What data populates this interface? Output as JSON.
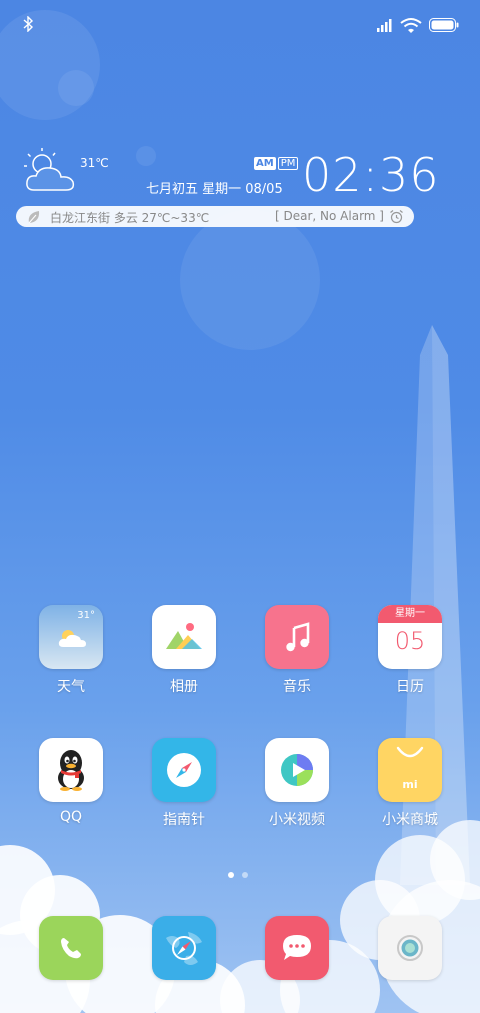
{
  "status_bar": {
    "left_icons": [
      "bluetooth-icon"
    ],
    "right_icons": [
      "signal-icon",
      "wifi-icon",
      "battery-icon"
    ]
  },
  "widget": {
    "weather_icon": "partly-cloudy-icon",
    "current_temp": "31℃",
    "am_label": "AM",
    "pm_label": "PM",
    "time": "02:36",
    "date_text": "七月初五   星期一   08/05",
    "location_text": "白龙江东街  多云  27℃~33℃",
    "alarm_text": "[ Dear, No Alarm ]",
    "leaf_icon": "leaf-icon",
    "alarm_icon": "alarm-clock-icon"
  },
  "apps": [
    {
      "label": "天气",
      "icon": "weather-app-icon",
      "badge": "31°"
    },
    {
      "label": "相册",
      "icon": "gallery-icon"
    },
    {
      "label": "音乐",
      "icon": "music-icon"
    },
    {
      "label": "日历",
      "icon": "calendar-icon",
      "cal_header": "星期一",
      "cal_day": "05"
    },
    {
      "label": "QQ",
      "icon": "qq-penguin-icon"
    },
    {
      "label": "指南针",
      "icon": "compass-icon"
    },
    {
      "label": "小米视频",
      "icon": "video-icon"
    },
    {
      "label": "小米商城",
      "icon": "mi-store-icon",
      "store_mark": "mi"
    }
  ],
  "page_indicator": {
    "count": 2,
    "active": 1
  },
  "dock": [
    {
      "icon": "phone-icon"
    },
    {
      "icon": "browser-icon"
    },
    {
      "icon": "messages-icon"
    },
    {
      "icon": "camera-icon"
    }
  ],
  "colors": {
    "background_top": "#4c86e3",
    "music": "#f7738d",
    "compass": "#33b6e8",
    "store": "#ffd563",
    "phone": "#9bd55b",
    "browser": "#3aaee8",
    "messages": "#f25a6f",
    "calendar_header": "#f25a6f"
  }
}
